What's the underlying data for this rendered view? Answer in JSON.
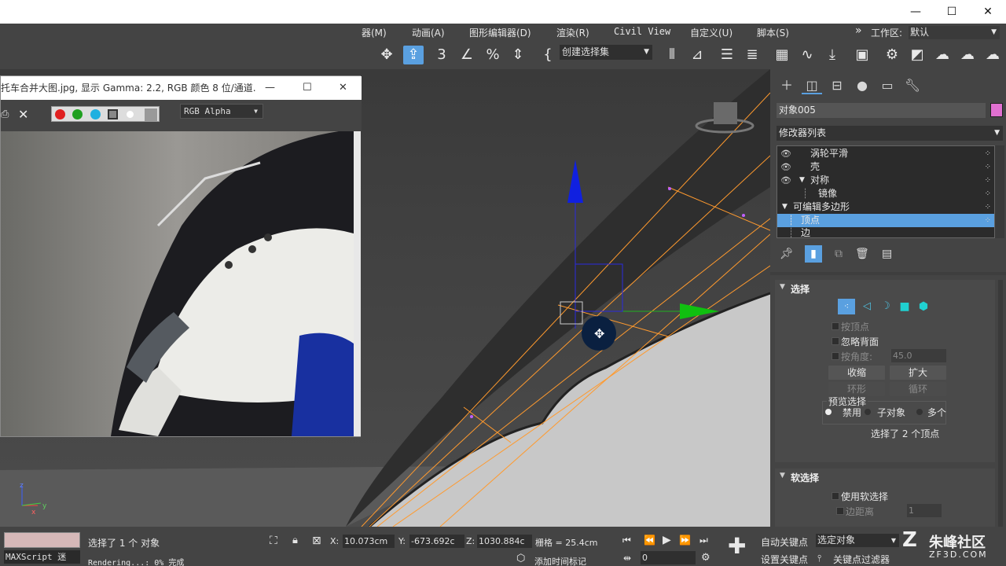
{
  "titlebar": {
    "minimize": "—",
    "maximize": "☐",
    "close": "✕"
  },
  "menubar": {
    "items": [
      "器(M)",
      "动画(A)",
      "图形编辑器(D)",
      "渲染(R)",
      "Civil View",
      "自定义(U)",
      "脚本(S)"
    ],
    "more": "»",
    "workspace_label": "工作区:",
    "workspace_value": "默认"
  },
  "toolbar": {
    "selection_set": "创建选择集"
  },
  "framebuffer": {
    "title": "托车合并大图.jpg, 显示 Gamma: 2.2, RGB 颜色 8 位/通道...",
    "channel": "RGB Alpha",
    "minimize": "—",
    "maximize": "☐",
    "close": "✕"
  },
  "command_panel": {
    "object_name": "对象005",
    "object_color": "#e070d0",
    "modifier_list": "修改器列表",
    "stack": [
      {
        "label": "涡轮平滑",
        "eye": true,
        "selected": false,
        "indent": 1
      },
      {
        "label": "壳",
        "eye": true,
        "selected": false,
        "indent": 1
      },
      {
        "label": "对称",
        "eye": true,
        "selected": false,
        "indent": 1
      },
      {
        "label": "镜像",
        "eye": false,
        "selected": false,
        "indent": 2
      },
      {
        "label": "可编辑多边形",
        "eye": false,
        "selected": false,
        "indent": 0
      },
      {
        "label": "顶点",
        "eye": false,
        "selected": true,
        "indent": 1
      },
      {
        "label": "边",
        "eye": false,
        "selected": false,
        "indent": 1
      }
    ],
    "selection": {
      "title": "选择",
      "by_vertex": "按顶点",
      "ignore_backfacing": "忽略背面",
      "by_angle": "按角度:",
      "angle_value": "45.0",
      "shrink": "收缩",
      "grow": "扩大",
      "ring": "环形",
      "loop": "循环",
      "preview_title": "预览选择",
      "preview_disabled": "禁用",
      "preview_subobject": "子对象",
      "preview_multi": "多个",
      "status": "选择了 2 个顶点"
    },
    "soft_selection": {
      "title": "软选择",
      "use_soft": "使用软选择",
      "edge_distance": "边距离",
      "edge_distance_value": "1"
    }
  },
  "viewport": {
    "axis_z": "z",
    "axis_x": "x",
    "axis_y": "y"
  },
  "statusbar": {
    "selected_objects": "选择了 1 个 对象",
    "rendering": "Rendering...: 0% 完成",
    "maxscript": "MAXScript 迷",
    "x_label": "X:",
    "x_value": "10.073cm",
    "y_label": "Y:",
    "y_value": "-673.692c",
    "z_label": "Z:",
    "z_value": "1030.884c",
    "grid": "栅格 = 25.4cm",
    "add_time_tag": "添加时间标记",
    "frame_value": "0",
    "auto_key": "自动关键点",
    "set_key": "设置关键点",
    "selected_object_dd": "选定对象",
    "key_filters": "关键点过滤器",
    "watermark": "朱峰社区",
    "watermark_url": "ZF3D.COM"
  }
}
